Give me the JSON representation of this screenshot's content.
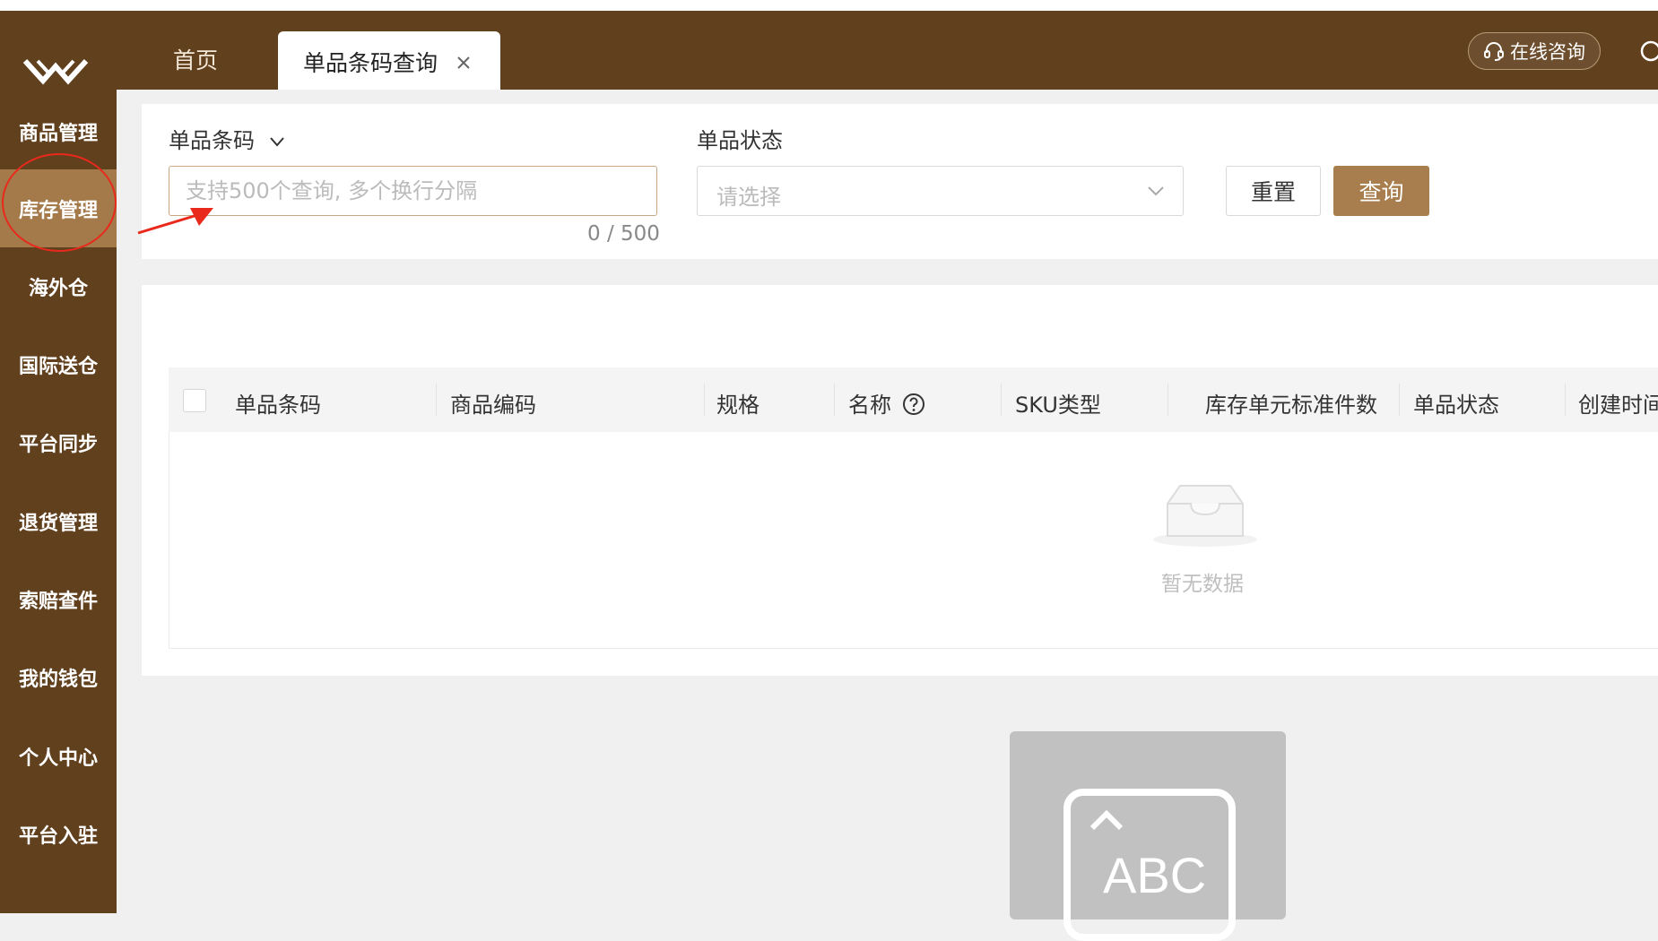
{
  "header": {
    "logo_icon": "brand-w-logo-icon",
    "tabs": [
      {
        "label": "首页"
      },
      {
        "label": "单品条码查询",
        "closable": true
      }
    ],
    "consult_label": "在线咨询",
    "consult_icon": "headset-icon",
    "search_icon": "search-icon"
  },
  "sidebar": {
    "items": [
      {
        "label": "商品管理"
      },
      {
        "label": "库存管理",
        "active": true
      },
      {
        "label": "海外仓"
      },
      {
        "label": "国际送仓"
      },
      {
        "label": "平台同步"
      },
      {
        "label": "退货管理"
      },
      {
        "label": "索赔查件"
      },
      {
        "label": "我的钱包"
      },
      {
        "label": "个人中心"
      },
      {
        "label": "平台入驻"
      }
    ]
  },
  "filters": {
    "barcode_label": "单品条码",
    "barcode_placeholder": "支持500个查询, 多个换行分隔",
    "barcode_value": "",
    "barcode_counter": "0 / 500",
    "status_label": "单品状态",
    "status_placeholder": "请选择",
    "reset_label": "重置",
    "query_label": "查询"
  },
  "table": {
    "columns": [
      "单品条码",
      "商品编码",
      "规格",
      "名称",
      "SKU类型",
      "库存单元标准件数",
      "单品状态",
      "创建时间"
    ],
    "rows": [],
    "empty_text": "暂无数据"
  },
  "ime": {
    "label": "ABC"
  },
  "colors": {
    "brand_dark": "#61401e",
    "brand_active": "#a47a4b",
    "primary_button": "#a87e4e",
    "annotation_red": "#e8291c"
  }
}
